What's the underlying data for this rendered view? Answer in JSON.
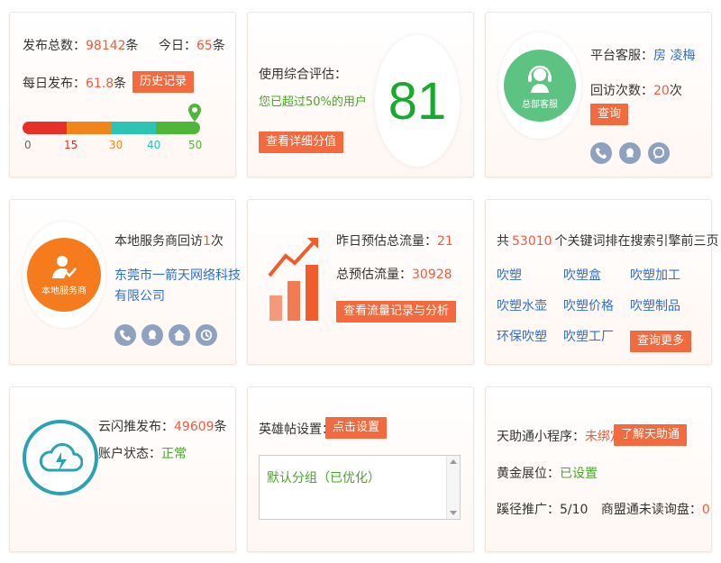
{
  "card1": {
    "publish_total_label": "发布总数：",
    "publish_total_value": "98142",
    "unit": "条",
    "today_label": "今日：",
    "today_value": "65",
    "daily_label": "每日发布：",
    "daily_value": "61.8",
    "history_button": "历史记录",
    "progress_ticks": [
      "0",
      "15",
      "30",
      "40",
      "50"
    ],
    "progress_value": 50,
    "colors": {
      "red": "#e8302a",
      "orange": "#f0841d",
      "teal": "#2dc4b4",
      "green": "#4fb63a"
    }
  },
  "card2": {
    "eval_label": "使用综合评估：",
    "eval_note": "您已超过50%的用户",
    "detail_button": "查看详细分值",
    "score": "81"
  },
  "card3": {
    "avatar_caption": "总部客服",
    "service_label": "平台客服：",
    "service_name": "房 凌梅",
    "visits_label": "回访次数：",
    "visits_value": "20",
    "visits_unit": "次",
    "query_button": "查询"
  },
  "card4": {
    "avatar_caption": "本地服务商",
    "visit_prefix": "本地服务商回访",
    "visit_count": "1",
    "visit_suffix": "次",
    "company_line1": "东莞市一箭天网络科技",
    "company_line2": "有限公司"
  },
  "card5": {
    "yesterday_label": "昨日预估总流量：",
    "yesterday_value": "21",
    "total_label": "总预估流量：",
    "total_value": "30928",
    "traffic_button": "查看流量记录与分析"
  },
  "card6": {
    "kw_prefix": "共",
    "kw_count": "53010",
    "kw_suffix": "个关键词排在搜索引擎前三页",
    "keywords": [
      "吹塑",
      "吹塑盒",
      "吹塑加工",
      "吹塑水壶",
      "吹塑价格",
      "吹塑制品",
      "环保吹塑",
      "吹塑工厂"
    ],
    "more_button": "查询更多"
  },
  "card7": {
    "push_label": "云闪推发布：",
    "push_value": "49609",
    "push_unit": "条",
    "status_label": "账户状态：",
    "status_value": "正常"
  },
  "card8": {
    "hero_label": "英雄帖设置：",
    "set_button": "点击设置",
    "listbox_item": "默认分组（已优化）"
  },
  "card9": {
    "miniprogram_label": "天助通小程序：",
    "miniprogram_value": "未绑定",
    "learn_button": "了解天助通",
    "gold_label": "黄金展位：",
    "gold_value": "已设置",
    "path_label": "蹊径推广：",
    "path_value": "5/10",
    "inquiry_label": "商盟通未读询盘：",
    "inquiry_value": "0"
  }
}
